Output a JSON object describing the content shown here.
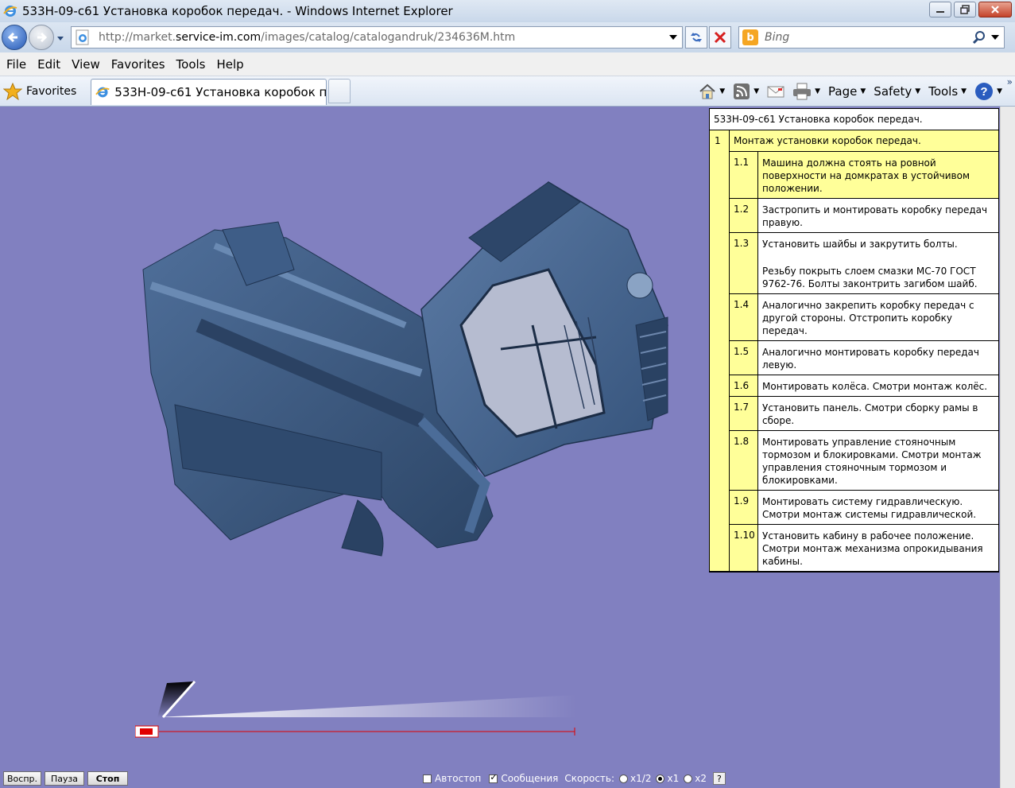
{
  "window": {
    "title": "533Н-09-с61 Установка коробок передач. - Windows Internet Explorer"
  },
  "address": {
    "url_prefix": "http://market.",
    "url_domain": "service-im.com",
    "url_path": "/images/catalog/catalogandruk/234636M.htm"
  },
  "search": {
    "placeholder": "Bing"
  },
  "menu": [
    "File",
    "Edit",
    "View",
    "Favorites",
    "Tools",
    "Help"
  ],
  "favbar": {
    "favorites_label": "Favorites",
    "tab_label": "533Н-09-с61 Установка коробок пе...",
    "tools": {
      "page": "Page",
      "safety": "Safety",
      "tools": "Tools"
    }
  },
  "instructions": {
    "header": "533Н-09-с61 Установка коробок передач.",
    "section": {
      "num": "1",
      "title": "Монтаж установки коробок передач."
    },
    "steps": [
      {
        "num": "1.1",
        "text": "Машина должна стоять на ровной поверхности на домкратах в устойчивом положении.",
        "active": true
      },
      {
        "num": "1.2",
        "text": "Застропить и монтировать коробку передач правую."
      },
      {
        "num": "1.3",
        "text": "Установить шайбы и закрутить болты.",
        "text2": "Резьбу покрыть слоем смазки МС-70 ГОСТ 9762-76. Болты законтрить загибом шайб."
      },
      {
        "num": "1.4",
        "text": "Аналогично закрепить коробку передач с другой стороны. Отстропить коробку передач."
      },
      {
        "num": "1.5",
        "text": "Аналогично монтировать коробку передач левую."
      },
      {
        "num": "1.6",
        "text": "Монтировать колёса. Смотри монтаж колёс."
      },
      {
        "num": "1.7",
        "text": "Установить панель. Смотри сборку рамы в сборе."
      },
      {
        "num": "1.8",
        "text": "Монтировать управление стояночным тормозом и блокировками. Смотри монтаж управления стояночным тормозом и блокировками."
      },
      {
        "num": "1.9",
        "text": "Монтировать систему гидравлическую. Смотри монтаж системы гидравлической."
      },
      {
        "num": "1.10",
        "text": "Установить кабину в рабочее положение. Смотри монтаж механизма опрокидывания кабины."
      }
    ]
  },
  "player": {
    "play": "Воспр.",
    "pause": "Пауза",
    "stop": "Стоп",
    "autostop": "Автостоп",
    "messages": "Сообщения",
    "speed_label": "Скорость:",
    "speed_half": "x1/2",
    "speed_1": "x1",
    "speed_2": "x2",
    "help": "?",
    "autostop_checked": false,
    "messages_checked": true,
    "selected_speed": "x1"
  },
  "colors": {
    "viewport_bg": "#8180c0",
    "model": "#3c5a82",
    "highlight": "#ffff99",
    "timeline_marker": "#e00000"
  }
}
